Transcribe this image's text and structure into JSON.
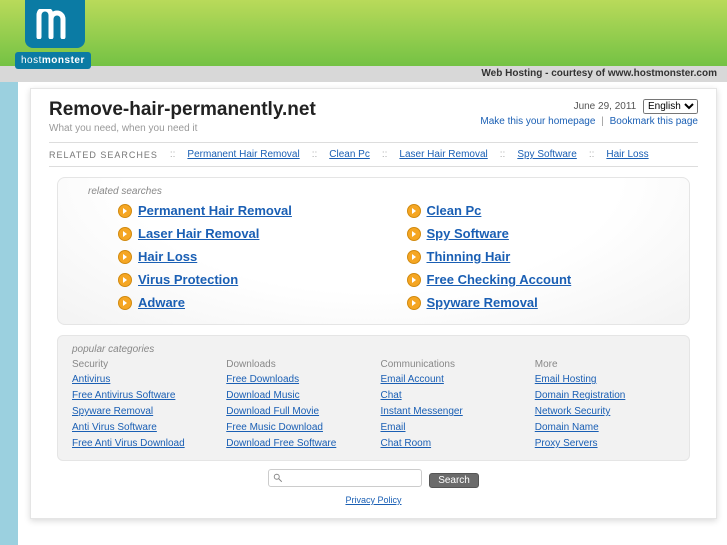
{
  "brand": {
    "name_a": "host",
    "name_b": "monster"
  },
  "courtesy": "Web Hosting - courtesy of www.hostmonster.com",
  "domain": "Remove-hair-permanently.net",
  "tagline": "What you need, when you need it",
  "date": "June 29, 2011",
  "language": {
    "selected": "English"
  },
  "meta_links": {
    "homepage": "Make this your homepage",
    "bookmark": "Bookmark this page"
  },
  "related_label": "RELATED SEARCHES",
  "related_inline": [
    "Permanent Hair Removal",
    "Clean Pc",
    "Laser Hair Removal",
    "Spy Software",
    "Hair Loss"
  ],
  "related_searches_title": "related searches",
  "related_searches": {
    "left": [
      "Permanent Hair Removal",
      "Laser Hair Removal",
      "Hair Loss",
      "Virus Protection",
      "Adware"
    ],
    "right": [
      "Clean Pc",
      "Spy Software",
      "Thinning Hair",
      "Free Checking Account",
      "Spyware Removal"
    ]
  },
  "popular_title": "popular categories",
  "categories": {
    "cols": [
      {
        "header": "Security",
        "links": [
          "Antivirus",
          "Free Antivirus Software",
          "Spyware Removal",
          "Anti Virus Software",
          "Free Anti Virus Download"
        ]
      },
      {
        "header": "Downloads",
        "links": [
          "Free Downloads",
          "Download Music",
          "Download Full Movie",
          "Free Music Download",
          "Download Free Software"
        ]
      },
      {
        "header": "Communications",
        "links": [
          "Email Account",
          "Chat",
          "Instant Messenger",
          "Email",
          "Chat Room"
        ]
      },
      {
        "header": "More",
        "links": [
          "Email Hosting",
          "Domain Registration",
          "Network Security",
          "Domain Name",
          "Proxy Servers"
        ]
      }
    ]
  },
  "search": {
    "button": "Search",
    "value": ""
  },
  "footer": {
    "privacy": "Privacy Policy"
  }
}
